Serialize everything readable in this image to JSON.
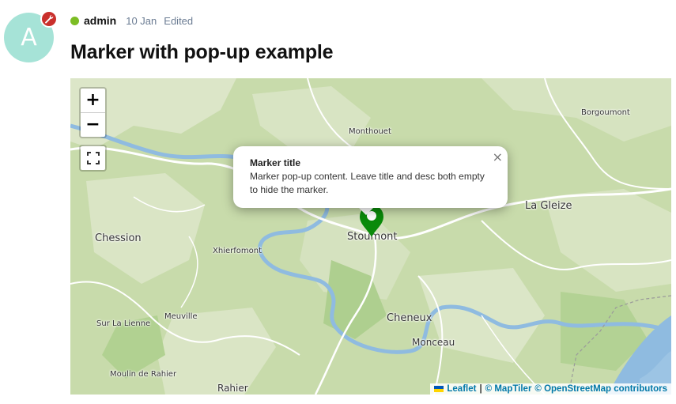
{
  "post": {
    "avatar_letter": "A",
    "author": "admin",
    "date": "10 Jan",
    "edited": "Edited",
    "title": "Marker with pop-up example",
    "status_color": "#7cbd24",
    "admin_badge_icon": "wrench-icon"
  },
  "map": {
    "zoom_in": "+",
    "zoom_out": "−",
    "places": {
      "monthouet": "Monthouet",
      "borgoumont": "Borgoumont",
      "la_gleize": "La Gleize",
      "stoumont": "Stoumont",
      "chession": "Chession",
      "xhierfomont": "Xhierfomont",
      "meuville": "Meuville",
      "sur_la_lienne": "Sur La Lienne",
      "cheneux": "Cheneux",
      "monceau": "Monceau",
      "moulin_de_rahier": "Moulin de Rahier",
      "rahier": "Rahier"
    },
    "marker_color": "#0a8a0a",
    "popup": {
      "title": "Marker title",
      "content": "Marker pop-up content. Leave title and desc both empty to hide the marker.",
      "close": "×"
    },
    "attribution": {
      "leaflet": "Leaflet",
      "sep": "|",
      "maptiler": "© MapTiler",
      "osm": "© OpenStreetMap contributors"
    }
  }
}
